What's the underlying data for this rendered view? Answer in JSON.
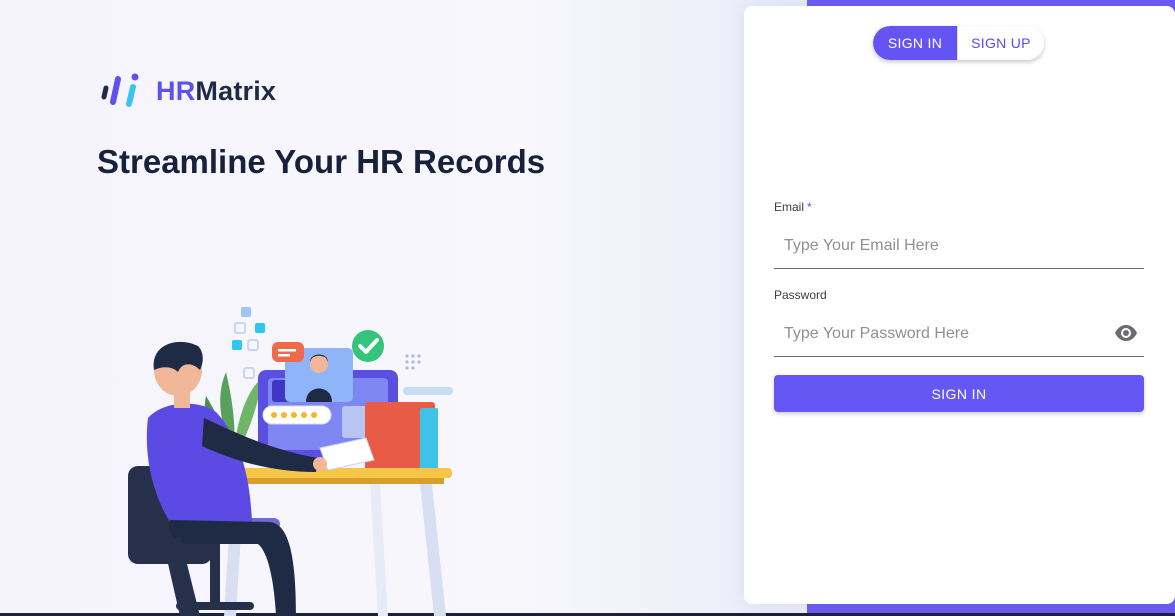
{
  "brand": {
    "logo_prefix": "HR",
    "logo_suffix": "Matrix",
    "logo_icon": "hrmatrix-logo-icon",
    "accent": "#6454f4"
  },
  "hero": {
    "headline": "Streamline Your HR Records",
    "illustration": "person-at-desk-video-interview-illustration"
  },
  "auth_toggle": {
    "sign_in_label": "SIGN IN",
    "sign_up_label": "SIGN UP",
    "active": "sign_in"
  },
  "form": {
    "email": {
      "label": "Email",
      "required_mark": "*",
      "placeholder": "Type Your Email Here",
      "value": ""
    },
    "password": {
      "label": "Password",
      "placeholder": "Type Your Password Here",
      "value": "",
      "toggle_icon": "eye-icon"
    },
    "submit_label": "SIGN IN"
  },
  "colors": {
    "button": "#6557f6",
    "side_band": "#6d5cf5",
    "heading": "#17213a"
  }
}
